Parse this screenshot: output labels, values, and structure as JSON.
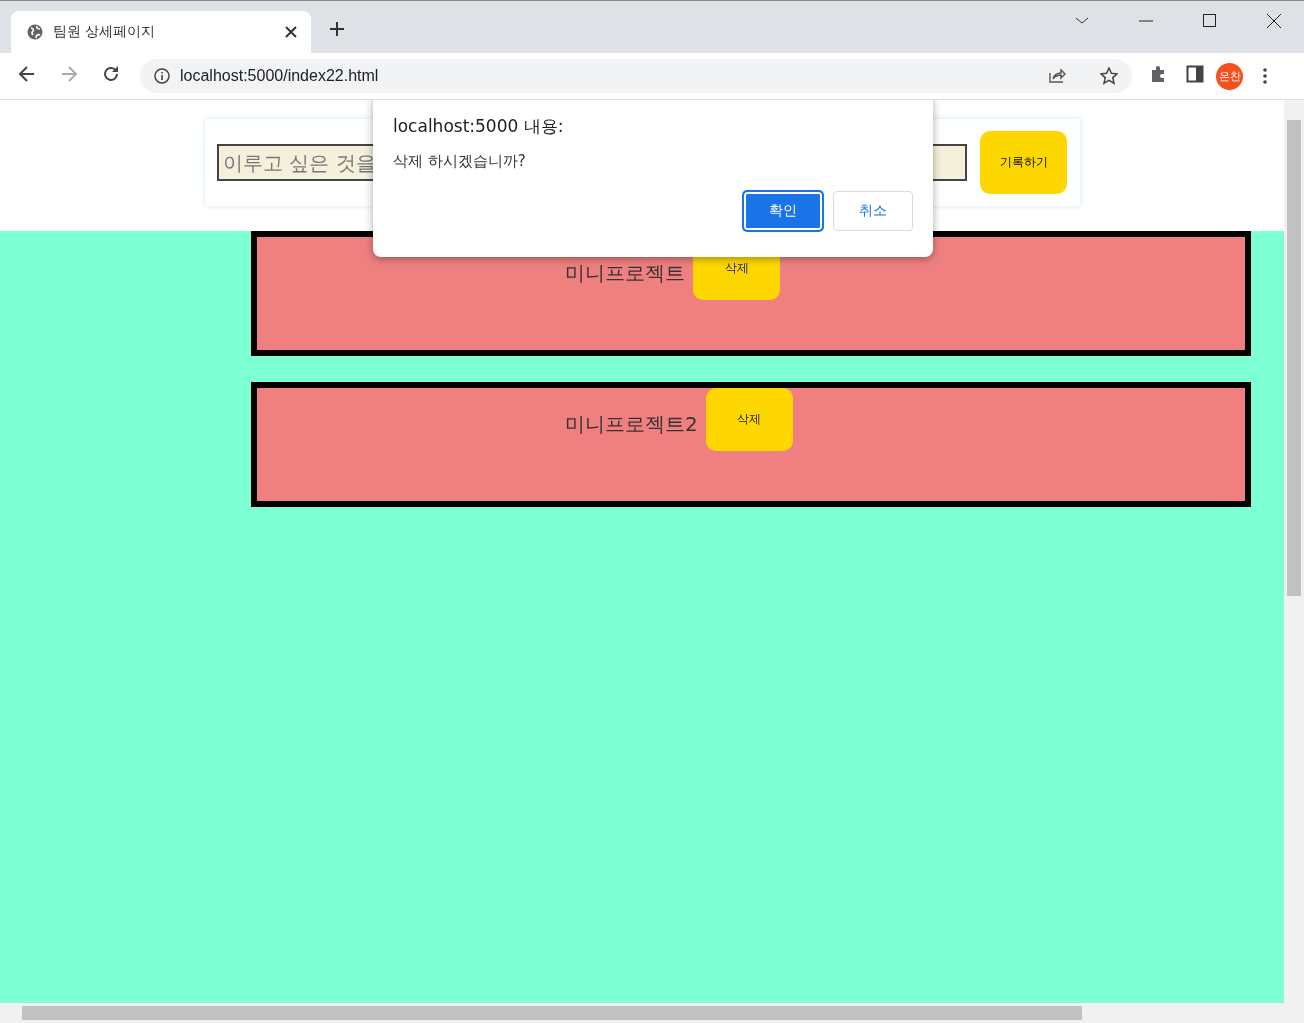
{
  "browser": {
    "tab_title": "팀원 상세페이지",
    "url": "localhost:5000/index22.html",
    "profile": "은찬"
  },
  "form": {
    "placeholder": "이루고 싶은 것을",
    "button": "기록하기"
  },
  "cards": [
    {
      "title": "미니프로젝트",
      "button": "삭제"
    },
    {
      "title": "미니프로젝트2",
      "button": "삭제"
    }
  ],
  "dialog": {
    "title": "localhost:5000 내용:",
    "message": "삭제 하시겠습니까?",
    "buttons": [
      {
        "label": "확인",
        "selected": true
      },
      {
        "label": "취소",
        "selected": false
      }
    ]
  }
}
